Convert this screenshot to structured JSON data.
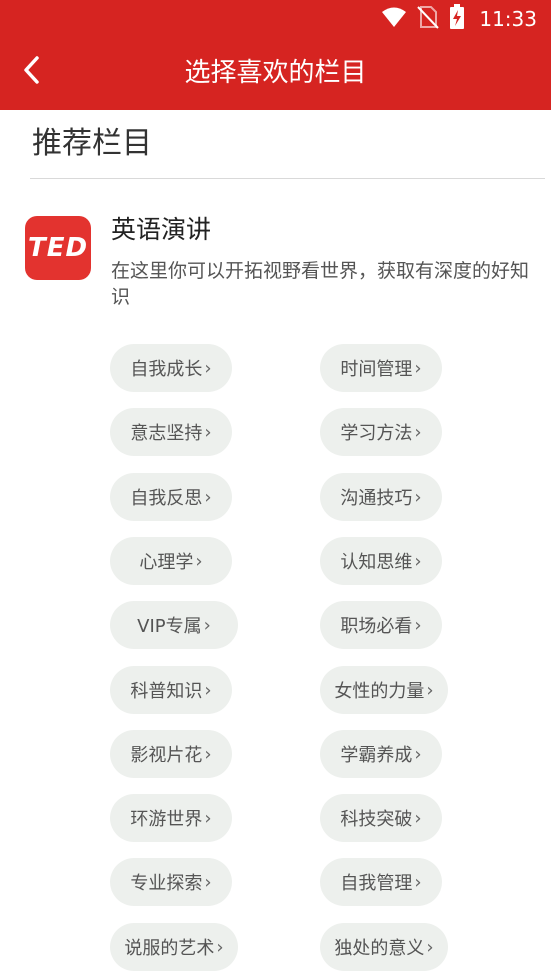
{
  "status_bar": {
    "time": "11:33"
  },
  "header": {
    "title": "选择喜欢的栏目"
  },
  "section": {
    "title": "推荐栏目"
  },
  "category": {
    "logo_text": "TED",
    "name": "英语演讲",
    "description": "在这里你可以开拓视野看世界，获取有深度的好知识"
  },
  "tags": {
    "left": [
      "自我成长",
      "意志坚持",
      "自我反思",
      "心理学",
      "VIP专属",
      "科普知识",
      "影视片花",
      "环游世界",
      "专业探索",
      "说服的艺术"
    ],
    "right": [
      "时间管理",
      "学习方法",
      "沟通技巧",
      "认知思维",
      "职场必看",
      "女性的力量",
      "学霸养成",
      "科技突破",
      "自我管理",
      "独处的意义"
    ],
    "chevron": "›"
  },
  "colors": {
    "header_bg": "#d62421",
    "logo_bg": "#e3332f",
    "tag_bg": "#edf0ed"
  }
}
